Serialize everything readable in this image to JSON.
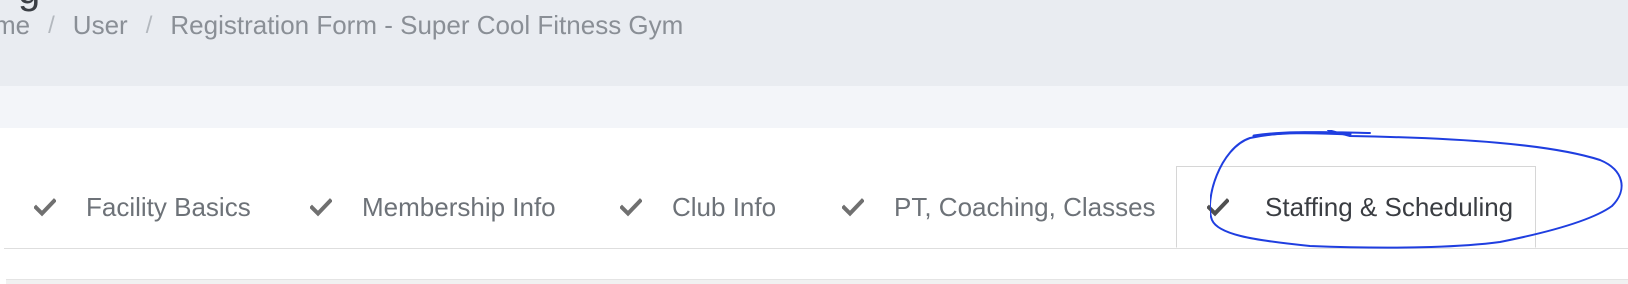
{
  "header": {
    "breadcrumb": [
      {
        "label": "me"
      },
      {
        "label": "User"
      },
      {
        "label": "Registration Form - Super Cool Fitness Gym"
      }
    ],
    "separator": "/"
  },
  "tabs": [
    {
      "label": "Facility Basics",
      "completed": true,
      "active": false
    },
    {
      "label": "Membership Info",
      "completed": true,
      "active": false
    },
    {
      "label": "Club Info",
      "completed": true,
      "active": false
    },
    {
      "label": "PT, Coaching, Classes",
      "completed": true,
      "active": false
    },
    {
      "label": "Staffing & Scheduling",
      "completed": true,
      "active": true
    }
  ],
  "icons": {
    "tab_status": "check-icon"
  },
  "colors": {
    "header_bg": "#e9ecf1",
    "strip_bg": "#f3f5f9",
    "check": "#707070",
    "annotation_stroke": "#1f3ee0"
  }
}
